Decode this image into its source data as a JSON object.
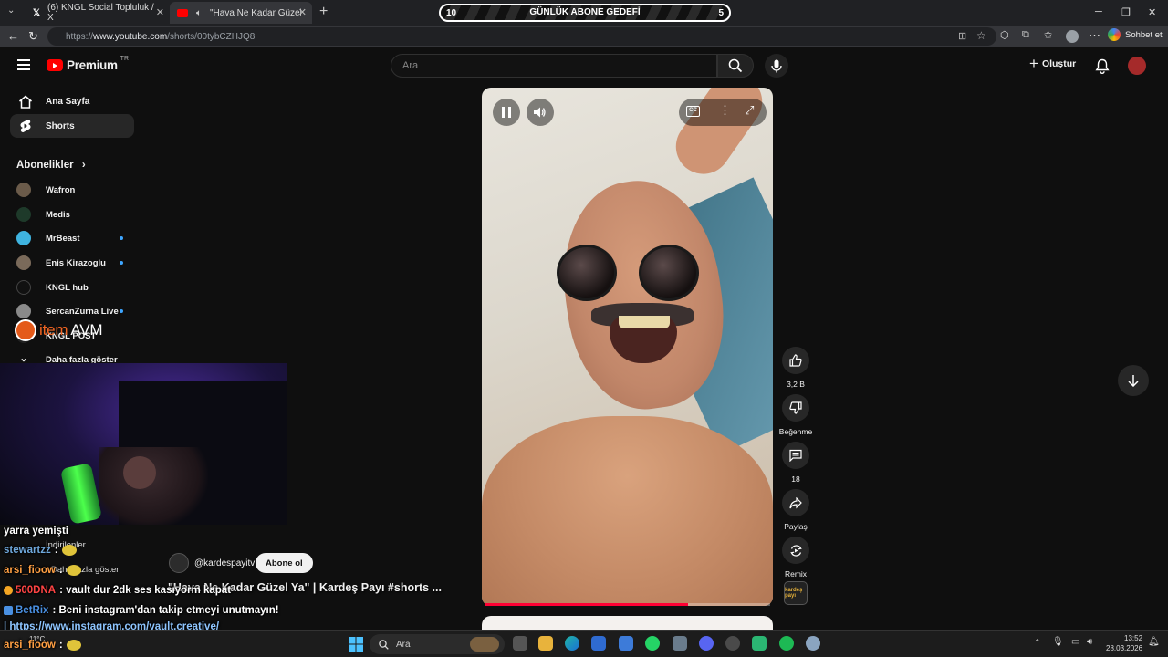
{
  "browser": {
    "tabs": [
      {
        "label": "(6) KNGL Social Topluluk / X"
      },
      {
        "label": "\"Hava Ne Kadar Güzel Ya\" | Ka"
      }
    ],
    "url_prefix": "https://",
    "url_host": "www.youtube.com",
    "url_path": "/shorts/00tybCZHJQ8",
    "chat_label": "Sohbet et"
  },
  "goal": {
    "left": "10",
    "title": "GÜNLÜK ABONE GEDEFİ",
    "right": "5"
  },
  "youtube": {
    "logo": "Premium",
    "region": "TR",
    "search_placeholder": "Ara",
    "create_label": "Oluştur",
    "nav": [
      {
        "label": "Ana Sayfa",
        "icon": "home-icon"
      },
      {
        "label": "Shorts",
        "icon": "shorts-icon"
      }
    ],
    "subs_title": "Abonelikler",
    "subscriptions": [
      {
        "name": "Wafron",
        "color": "#6b5b4a",
        "live": false
      },
      {
        "name": "Medis",
        "color": "#1e3a2a",
        "live": false
      },
      {
        "name": "MrBeast",
        "color": "#3fb4e0",
        "live": true
      },
      {
        "name": "Enis Kirazoglu",
        "color": "#7a6a5a",
        "live": true
      },
      {
        "name": "KNGL hub",
        "color": "#111111",
        "live": false
      },
      {
        "name": "SercanZurna Live",
        "color": "#8a8a8a",
        "live": true
      },
      {
        "name": "KNGL POST",
        "color": "#222222",
        "live": false
      }
    ],
    "show_more": "Daha fazla göster",
    "hidden_items": [
      "İndirilenler",
      "Daha fazla göster"
    ]
  },
  "overlay": {
    "brand_item": "item",
    "brand_avm": "AVM",
    "chat": [
      {
        "user": "",
        "text": "yarra yemişti",
        "color": "#ffffff",
        "emote": false
      },
      {
        "user": "stewartzz",
        "text": ":",
        "color": "#6fa8dc",
        "emote": true
      },
      {
        "user": "arsi_fioow",
        "text": ":",
        "color": "#ff9f43",
        "emote": true
      },
      {
        "user": "500DNA",
        "text": ": vault dur 2dk ses kasıyorm kapat",
        "color": "#ff4444",
        "emote": false
      },
      {
        "user": "BetRix",
        "text": ": Beni instagram'dan takip etmeyi unutmayın!",
        "color": "#4a90e2",
        "emote": false
      },
      {
        "user": "",
        "text": "| https://www.instagram.com/vault.creative/",
        "color": "#8ec5ff",
        "emote": false
      },
      {
        "user": "arsi_fioow",
        "text": ":",
        "color": "#ff9f43",
        "emote": true
      }
    ]
  },
  "short": {
    "channel": "@kardespayitv",
    "subscribe_label": "Abone ol",
    "title": "\"Hava Ne Kadar Güzel Ya\" | Kardeş Payı #shorts ...",
    "progress": 0.71,
    "likes": "3,2 B",
    "dislike_label": "Beğenme",
    "comments": "18",
    "share_label": "Paylaş",
    "remix_label": "Remix",
    "channel_thumb": "kardeş payı"
  },
  "taskbar": {
    "search_placeholder": "Ara",
    "weather": "11°C",
    "time": "13:52",
    "date": "28.03.2026"
  }
}
